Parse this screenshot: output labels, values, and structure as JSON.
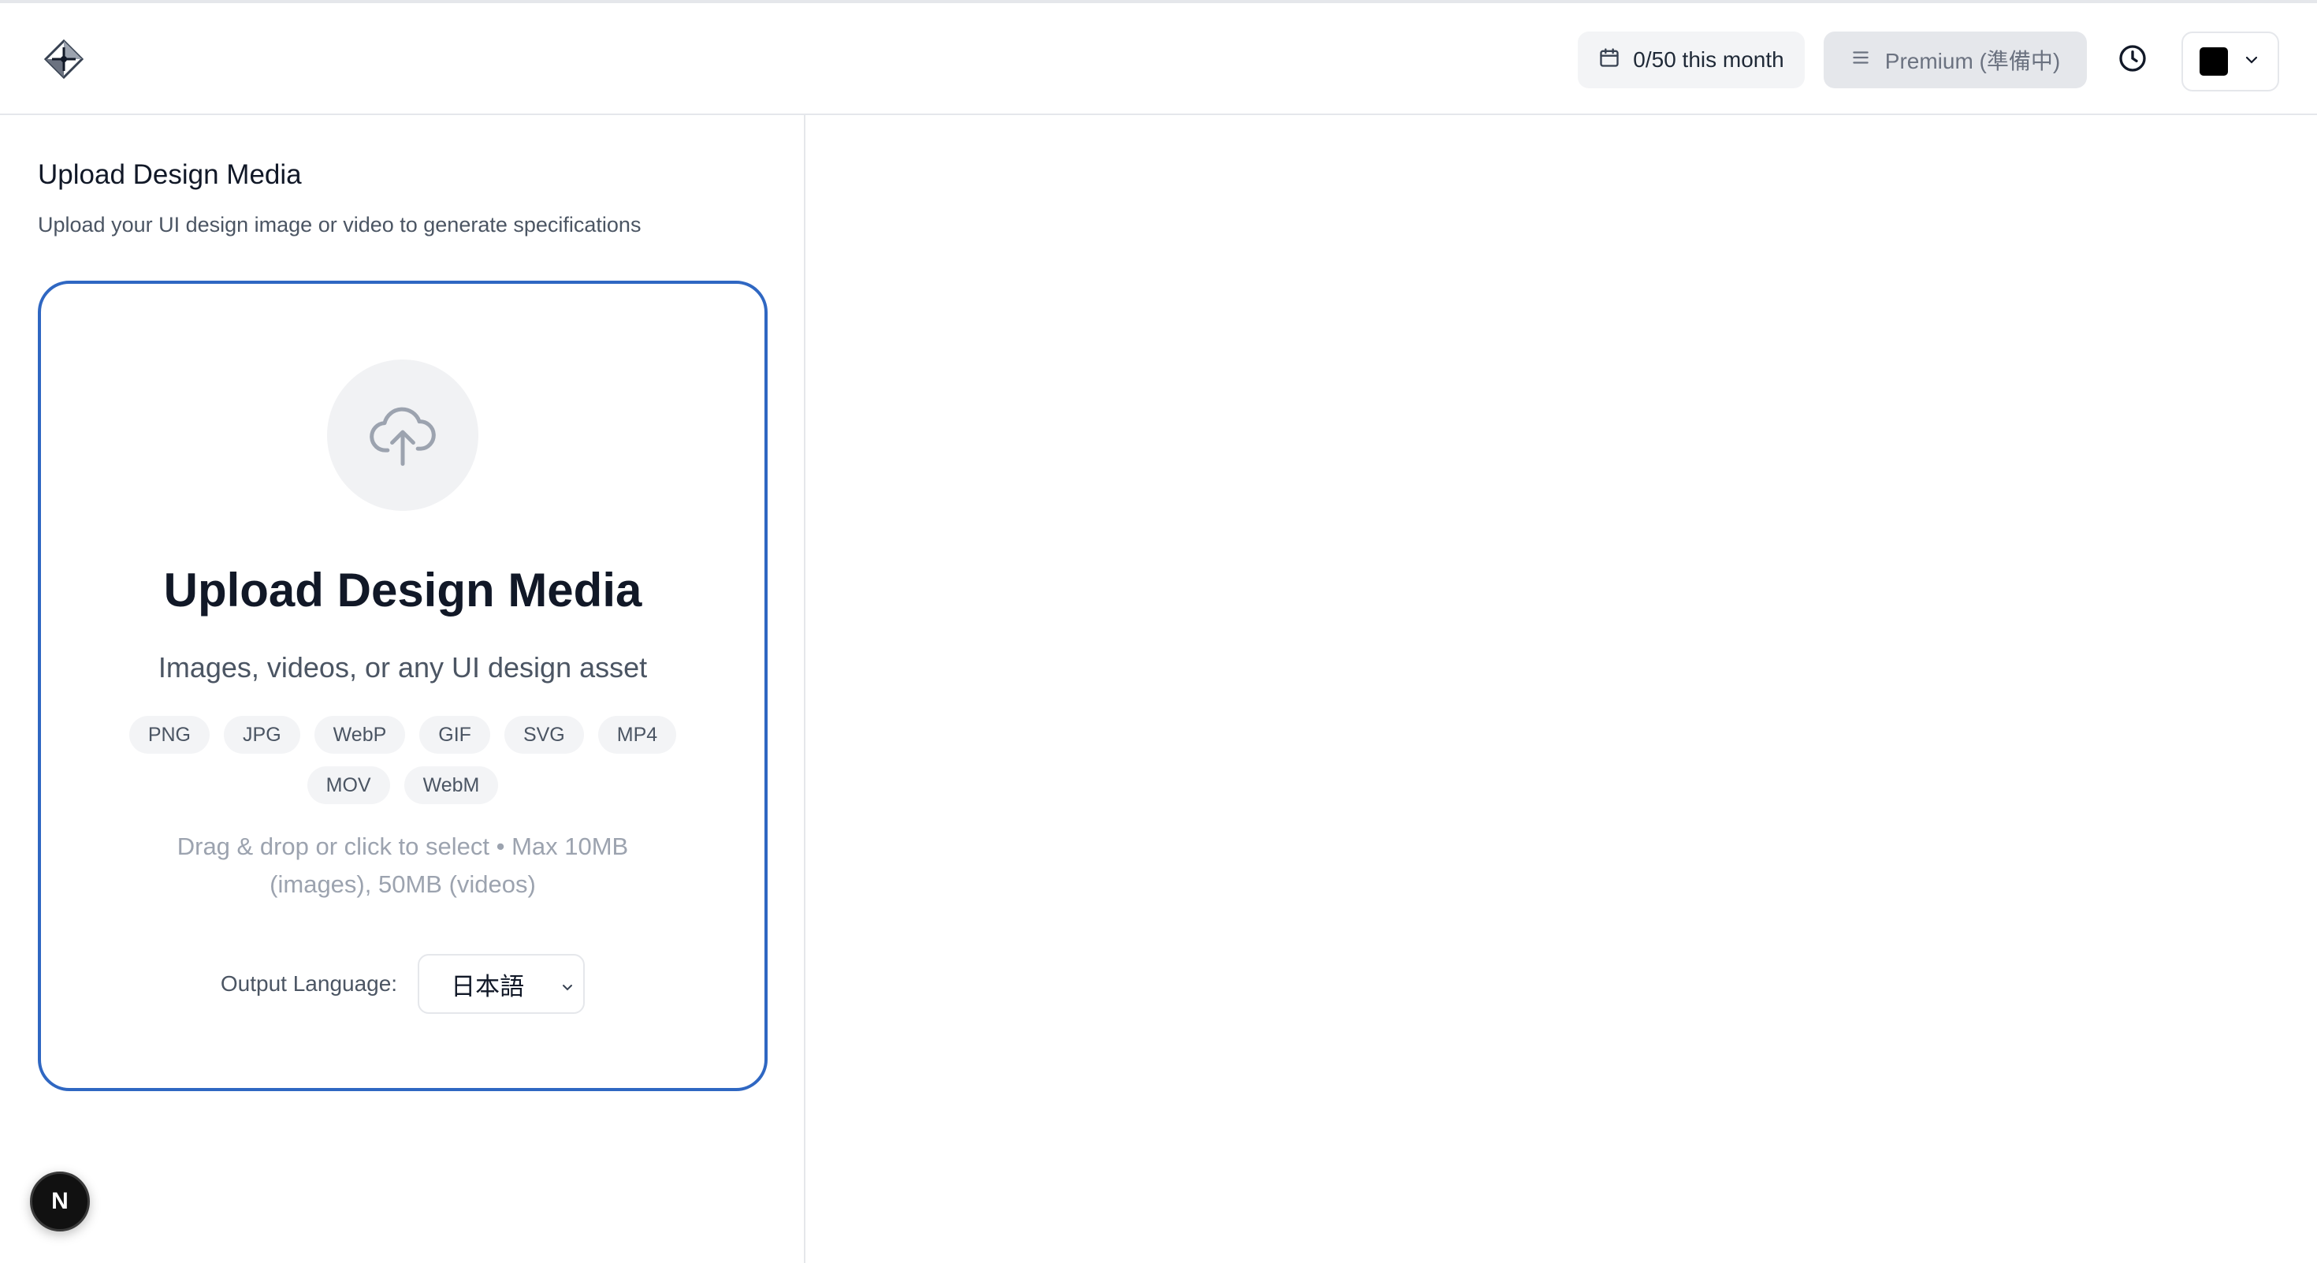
{
  "header": {
    "logo_icon": "diamond-compass-icon",
    "usage_label": "0/50 this month",
    "usage_icon": "calendar-icon",
    "premium_label": "Premium (準備中)",
    "premium_icon": "menu-lines-icon",
    "history_icon": "clock-icon",
    "color_swatch": "#000000",
    "color_dropdown_icon": "chevron-down-icon"
  },
  "left_panel": {
    "title": "Upload Design Media",
    "subtitle": "Upload your UI design image or video to generate specifications"
  },
  "dropzone": {
    "icon": "cloud-upload-icon",
    "title": "Upload Design Media",
    "subtitle": "Images, videos, or any UI design asset",
    "formats": [
      "PNG",
      "JPG",
      "WebP",
      "GIF",
      "SVG",
      "MP4",
      "MOV",
      "WebM"
    ],
    "hint": "Drag & drop or click to select • Max 10MB (images), 50MB (videos)",
    "border_color": "#2f67c2"
  },
  "output_language": {
    "label": "Output Language:",
    "selected": "日本語"
  },
  "dev_badge": {
    "letter": "N"
  }
}
